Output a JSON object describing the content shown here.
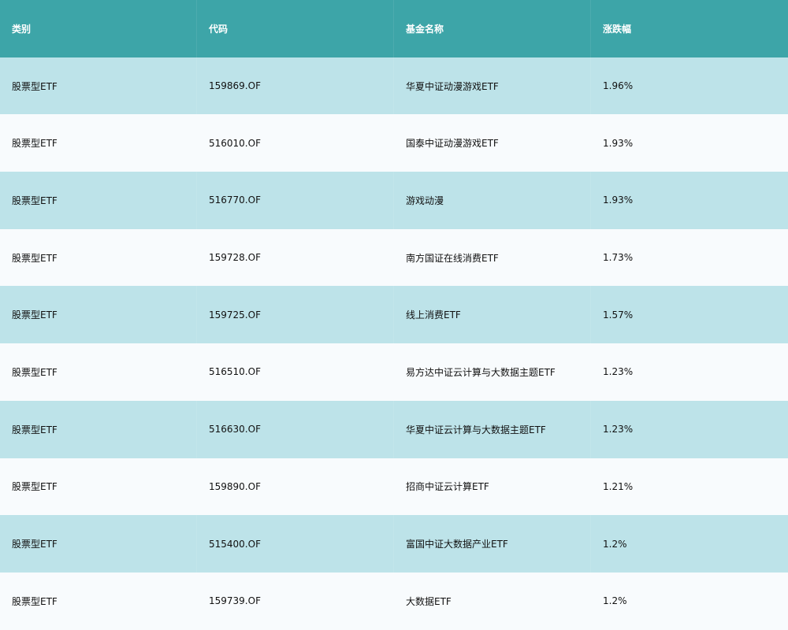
{
  "table": {
    "columns": [
      "类别",
      "代码",
      "基金名称",
      "涨跌幅"
    ],
    "rows": [
      [
        "股票型ETF",
        "159869.OF",
        "华夏中证动漫游戏ETF",
        "1.96%"
      ],
      [
        "股票型ETF",
        "516010.OF",
        "国泰中证动漫游戏ETF",
        "1.93%"
      ],
      [
        "股票型ETF",
        "516770.OF",
        "游戏动漫",
        "1.93%"
      ],
      [
        "股票型ETF",
        "159728.OF",
        "南方国证在线消费ETF",
        "1.73%"
      ],
      [
        "股票型ETF",
        "159725.OF",
        "线上消费ETF",
        "1.57%"
      ],
      [
        "股票型ETF",
        "516510.OF",
        "易方达中证云计算与大数据主题ETF",
        "1.23%"
      ],
      [
        "股票型ETF",
        "516630.OF",
        "华夏中证云计算与大数据主题ETF",
        "1.23%"
      ],
      [
        "股票型ETF",
        "159890.OF",
        "招商中证云计算ETF",
        "1.21%"
      ],
      [
        "股票型ETF",
        "515400.OF",
        "富国中证大数据产业ETF",
        "1.2%"
      ],
      [
        "股票型ETF",
        "159739.OF",
        "大数据ETF",
        "1.2%"
      ]
    ]
  },
  "colors": {
    "header_bg": "#3da5a8",
    "odd_row_bg": "#bde3e9",
    "even_row_bg": "#f8fbfd"
  }
}
